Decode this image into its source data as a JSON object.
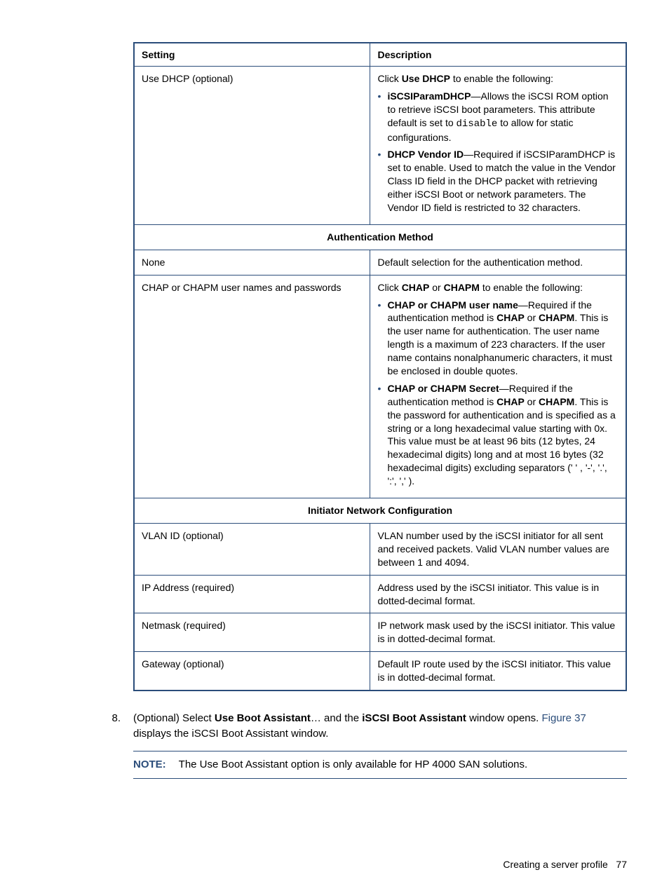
{
  "table": {
    "header": {
      "setting": "Setting",
      "description": "Description"
    },
    "row_dhcp": {
      "setting": "Use DHCP (optional)",
      "intro_pre": "Click ",
      "intro_bold": "Use DHCP",
      "intro_post": " to enable the following:",
      "item1_bold": "iSCSIParamDHCP",
      "item1_text_a": "—Allows the iSCSI ROM option to retrieve iSCSI boot parameters. This attribute default is set to ",
      "item1_mono": "disable",
      "item1_text_b": " to allow for static configurations.",
      "item2_bold": "DHCP Vendor ID",
      "item2_text": "—Required if iSCSIParamDHCP is set to enable. Used to match the value in the Vendor Class ID field in the DHCP packet with retrieving either iSCSI Boot or network parameters. The Vendor ID field is restricted to 32 characters."
    },
    "section_auth": "Authentication Method",
    "row_none": {
      "setting": "None",
      "desc": "Default selection for the authentication method."
    },
    "row_chap": {
      "setting": "CHAP or CHAPM user names and passwords",
      "intro_pre": "Click ",
      "intro_b1": "CHAP",
      "intro_or": " or ",
      "intro_b2": "CHAPM",
      "intro_post": " to enable the following:",
      "item1_bold": "CHAP or CHAPM user name",
      "item1_a": "—Required if the authentication method is ",
      "item1_b1": "CHAP",
      "item1_or": " or ",
      "item1_b2": "CHAPM",
      "item1_b": ". This is the user name for authentication. The user name length is a maximum of 223 characters. If the user name contains nonalphanumeric characters, it must be enclosed in double quotes.",
      "item2_bold": "CHAP or CHAPM Secret",
      "item2_a": "—Required if the authentication method is ",
      "item2_b1": "CHAP",
      "item2_or": " or ",
      "item2_b2": "CHAPM",
      "item2_b": ". This is the password for authentication and is specified as a string or a long hexadecimal value starting with 0x. This value must be at least 96 bits (12 bytes, 24 hexadecimal digits) long and at most 16 bytes (32 hexadecimal digits) excluding separators (' ' , '-', '.', ':', ',' )."
    },
    "section_init": "Initiator Network Configuration",
    "row_vlan": {
      "setting": "VLAN ID (optional)",
      "desc": "VLAN number used by the iSCSI initiator for all sent and received packets. Valid VLAN number values are between 1 and 4094."
    },
    "row_ip": {
      "setting": "IP Address (required)",
      "desc": "Address used by the iSCSI initiator. This value is in dotted-decimal format."
    },
    "row_netmask": {
      "setting": "Netmask (required)",
      "desc": "IP network mask used by the iSCSI initiator. This value is in dotted-decimal format."
    },
    "row_gateway": {
      "setting": "Gateway (optional)",
      "desc": "Default IP route used by the iSCSI initiator. This value is in dotted-decimal format."
    }
  },
  "step": {
    "number": "8.",
    "a": "(Optional) Select ",
    "b1": "Use Boot Assistant",
    "b": "… and the ",
    "b2": "iSCSI Boot Assistant",
    "c": " window opens. ",
    "link": "Figure 37",
    "d": " displays the iSCSI Boot Assistant window."
  },
  "note": {
    "label": "NOTE:",
    "text": "The Use Boot Assistant option is only available for HP 4000 SAN solutions."
  },
  "footer": {
    "text": "Creating a server profile",
    "page": "77"
  }
}
